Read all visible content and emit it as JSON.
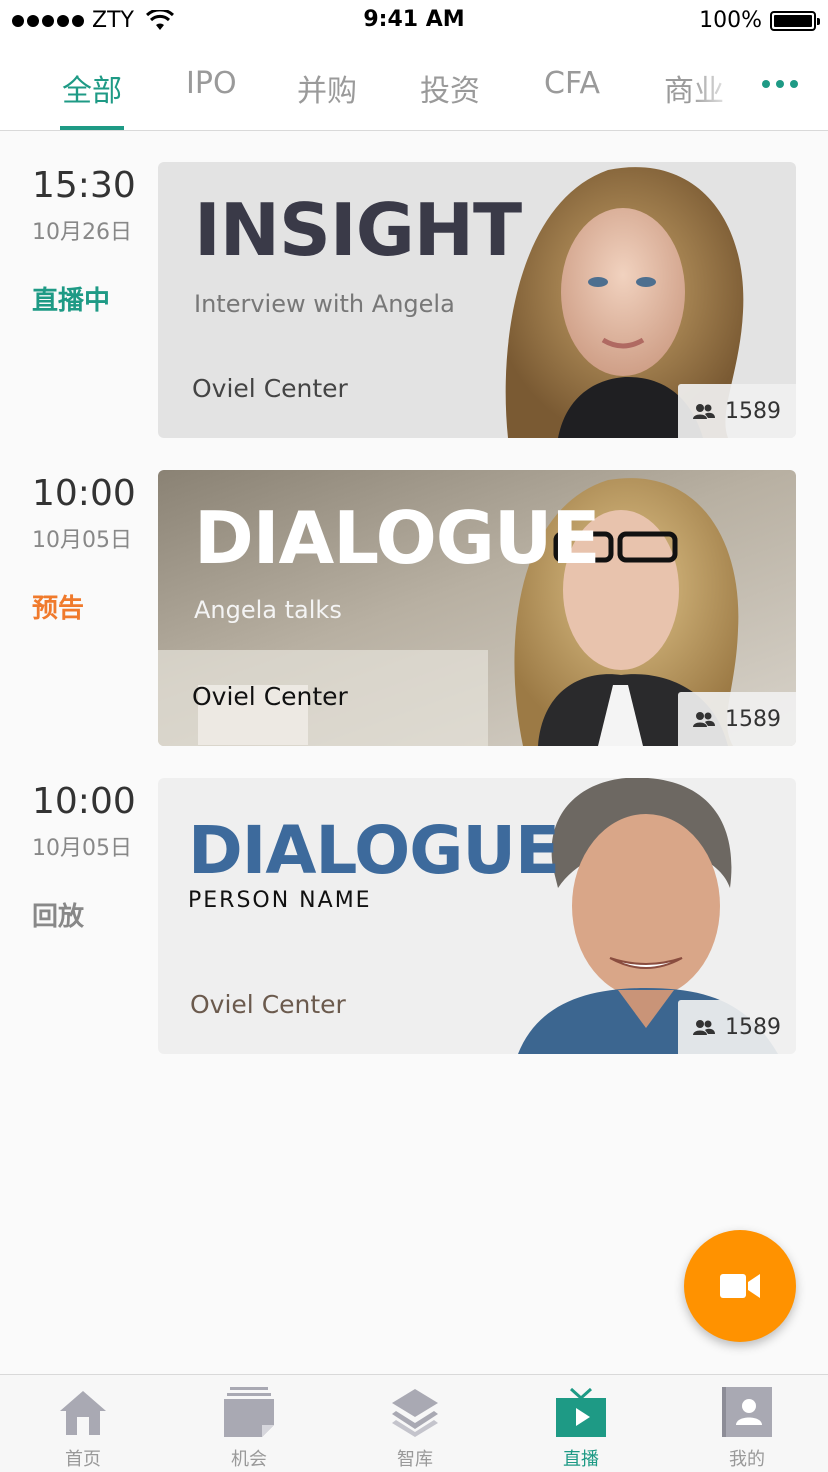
{
  "status_bar": {
    "carrier": "ZTY",
    "time": "9:41 AM",
    "battery": "100%"
  },
  "tabs": [
    {
      "label": "全部",
      "active": true
    },
    {
      "label": "IPO"
    },
    {
      "label": "并购"
    },
    {
      "label": "投资"
    },
    {
      "label": "CFA"
    },
    {
      "label": "商业"
    }
  ],
  "events": [
    {
      "time": "15:30",
      "date": "10月26日",
      "status": "直播中",
      "status_color": "#1e9a85",
      "card": {
        "title": "INSIGHT",
        "subtitle": "Interview with Angela",
        "location": "Oviel Center",
        "viewers": "1589"
      }
    },
    {
      "time": "10:00",
      "date": "10月05日",
      "status": "预告",
      "status_color": "#f07a2c",
      "card": {
        "title": "DIALOGUE",
        "subtitle": "Angela talks",
        "location": "Oviel Center",
        "viewers": "1589"
      }
    },
    {
      "time": "10:00",
      "date": "10月05日",
      "status": "回放",
      "status_color": "#888888",
      "card": {
        "title": "DIALOGUE",
        "subtitle": "PERSON NAME",
        "location": "Oviel Center",
        "viewers": "1589"
      }
    }
  ],
  "fab": {
    "icon": "video-camera-icon",
    "color": "#ff9200"
  },
  "bottom_nav": [
    {
      "label": "首页",
      "icon": "home-icon"
    },
    {
      "label": "机会",
      "icon": "opportunity-icon"
    },
    {
      "label": "智库",
      "icon": "layers-icon"
    },
    {
      "label": "直播",
      "icon": "live-tv-icon",
      "active": true
    },
    {
      "label": "我的",
      "icon": "profile-icon"
    }
  ]
}
